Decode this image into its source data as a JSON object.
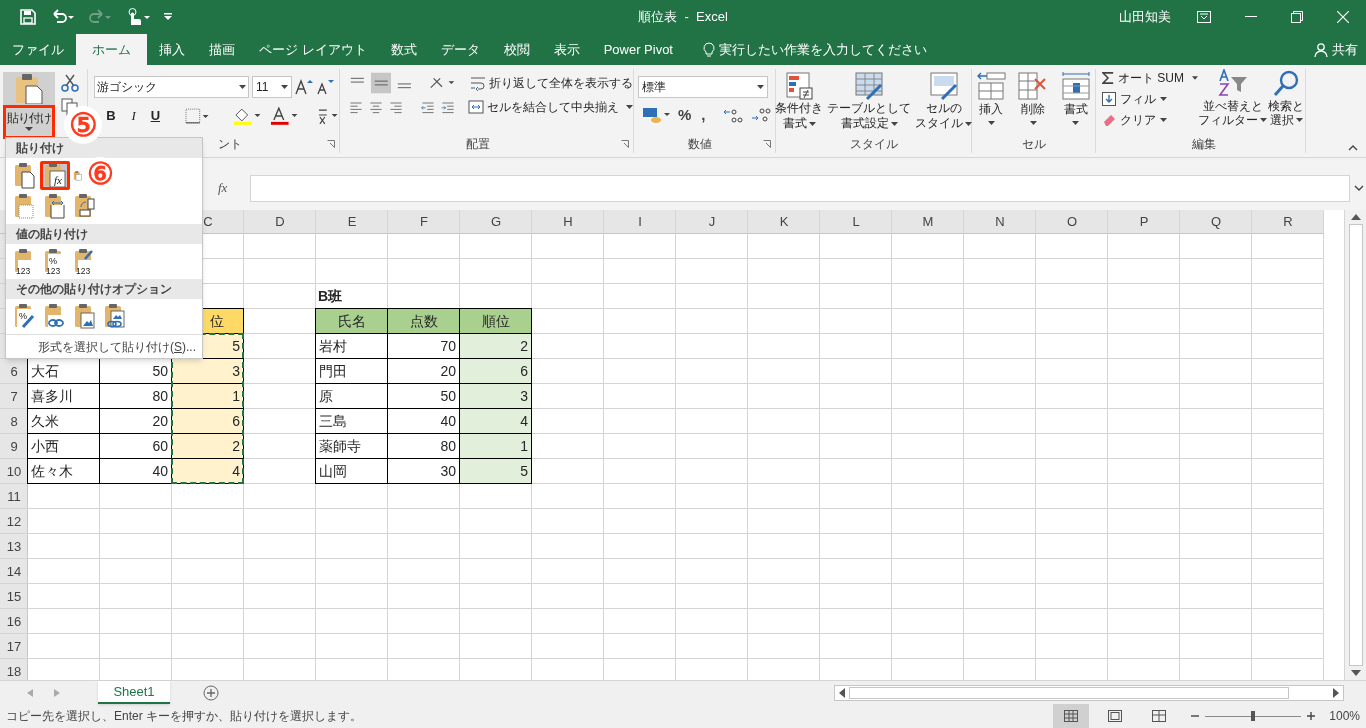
{
  "title_bar": {
    "title": "順位表  -  Excel",
    "user": "山田知美"
  },
  "tabs": [
    {
      "label": "ファイル",
      "selected": false
    },
    {
      "label": "ホーム",
      "selected": true
    },
    {
      "label": "挿入",
      "selected": false
    },
    {
      "label": "描画",
      "selected": false
    },
    {
      "label": "ページ レイアウト",
      "selected": false
    },
    {
      "label": "数式",
      "selected": false
    },
    {
      "label": "データ",
      "selected": false
    },
    {
      "label": "校閲",
      "selected": false
    },
    {
      "label": "表示",
      "selected": false
    },
    {
      "label": "Power Pivot",
      "selected": false
    }
  ],
  "tell_me": "実行したい作業を入力してください",
  "share": "共有",
  "clipboard": {
    "paste_label": "貼り付け",
    "paste_highlighted": true,
    "step": "⑤"
  },
  "font": {
    "name": "游ゴシック",
    "size": "11",
    "bold": "B",
    "italic": "I",
    "underline": "U",
    "group_label": "ント"
  },
  "alignment": {
    "wrap_text": "折り返して全体を表示する",
    "merge_center": "セルを結合して中央揃え",
    "group_label": "配置"
  },
  "number": {
    "format": "標準",
    "percent": "%",
    "comma": ",",
    "group_label": "数値"
  },
  "styles": {
    "buttons": [
      {
        "kind": "conditional",
        "lines": [
          "条件付き",
          "書式"
        ]
      },
      {
        "kind": "table",
        "lines": [
          "テーブルとして",
          "書式設定"
        ]
      },
      {
        "kind": "cell_styles",
        "lines": [
          "セルの",
          "スタイル"
        ]
      }
    ],
    "group_label": "スタイル"
  },
  "cells": {
    "buttons": [
      {
        "kind": "insert",
        "label": "挿入"
      },
      {
        "kind": "delete",
        "label": "削除"
      },
      {
        "kind": "format",
        "label": "書式"
      }
    ],
    "group_label": "セル"
  },
  "editing": {
    "autosum": "オート SUM",
    "fill": "フィル",
    "clear": "クリア",
    "sort": [
      "並べ替えと",
      "フィルター"
    ],
    "find": [
      "検索と",
      "選択"
    ],
    "group_label": "編集"
  },
  "formula_bar": {
    "fx": "fx"
  },
  "columns": [
    "C",
    "D",
    "E",
    "F",
    "G",
    "H",
    "I",
    "J",
    "K",
    "L",
    "M",
    "N",
    "O",
    "P",
    "Q",
    "R"
  ],
  "row_numbers": [
    "6",
    "7",
    "8",
    "9",
    "10",
    "11",
    "12",
    "13",
    "14",
    "15",
    "16",
    "17",
    "18"
  ],
  "table_a": {
    "header_visible": "位",
    "rank_column_copied": true,
    "rows": [
      {
        "rank": "5"
      },
      {
        "name": "大石",
        "score": "50",
        "rank": "3"
      },
      {
        "name": "喜多川",
        "score": "80",
        "rank": "1"
      },
      {
        "name": "久米",
        "score": "20",
        "rank": "6"
      },
      {
        "name": "小西",
        "score": "60",
        "rank": "2"
      },
      {
        "name": "佐々木",
        "score": "40",
        "rank": "4"
      }
    ]
  },
  "table_b": {
    "title": "B班",
    "headers": [
      "氏名",
      "点数",
      "順位"
    ],
    "rows": [
      {
        "name": "岩村",
        "score": "70",
        "rank": "2"
      },
      {
        "name": "門田",
        "score": "20",
        "rank": "6"
      },
      {
        "name": "原",
        "score": "50",
        "rank": "3"
      },
      {
        "name": "三島",
        "score": "40",
        "rank": "4"
      },
      {
        "name": "薬師寺",
        "score": "80",
        "rank": "1"
      },
      {
        "name": "山岡",
        "score": "30",
        "rank": "5"
      }
    ]
  },
  "paste_menu": {
    "step": "⑥",
    "sections": [
      {
        "title": "貼り付け",
        "options": [
          {
            "kind": "paste",
            "highlighted": false
          },
          {
            "kind": "formulas",
            "glyph": "fx",
            "highlighted": true
          },
          {
            "kind": "formulas_number",
            "highlighted": false
          },
          {
            "kind": "no_borders",
            "highlighted": false
          },
          {
            "kind": "keep_widths",
            "highlighted": false
          },
          {
            "kind": "transpose",
            "highlighted": false
          }
        ]
      },
      {
        "title": "値の貼り付け",
        "options": [
          {
            "kind": "values",
            "glyph": "123",
            "highlighted": false
          },
          {
            "kind": "values_number",
            "glyph": "123",
            "mark": "%",
            "highlighted": false
          },
          {
            "kind": "values_source",
            "glyph": "123",
            "highlighted": false
          }
        ]
      },
      {
        "title": "その他の貼り付けオプション",
        "options": [
          {
            "kind": "formatting",
            "mark": "%",
            "highlighted": false
          },
          {
            "kind": "link",
            "highlighted": false
          },
          {
            "kind": "picture",
            "highlighted": false
          },
          {
            "kind": "linked_picture",
            "highlighted": false
          }
        ]
      }
    ],
    "special": {
      "before": "形式を選択して貼り付け(",
      "key": "S",
      "after": ")..."
    }
  },
  "sheet_tabs": [
    {
      "label": "Sheet1",
      "selected": true
    }
  ],
  "status_bar": {
    "message": "コピー先を選択し、Enter キーを押すか、貼り付けを選択します。",
    "views": [
      {
        "kind": "normal",
        "selected": true
      },
      {
        "kind": "page_layout",
        "selected": false
      },
      {
        "kind": "page_break",
        "selected": false
      }
    ],
    "zoom": {
      "level": 0.5,
      "reading": "100%"
    }
  }
}
